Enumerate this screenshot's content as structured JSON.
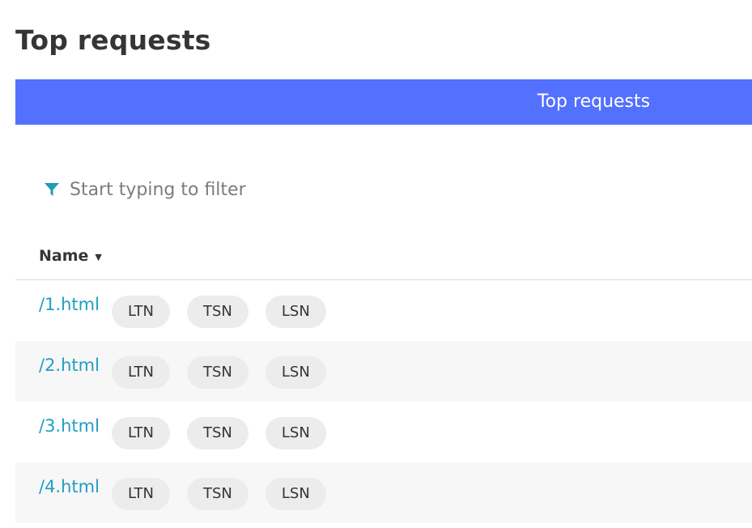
{
  "page": {
    "title": "Top requests"
  },
  "tabs": [
    {
      "label": "Top requests"
    }
  ],
  "filter": {
    "placeholder": "Start typing to filter",
    "icon": "filter-icon"
  },
  "table": {
    "columns": [
      {
        "label": "Name",
        "sort": "descending",
        "sort_icon": "caret-down-icon"
      }
    ],
    "rows": [
      {
        "name": "/1.html",
        "tags": [
          "LTN",
          "TSN",
          "LSN"
        ]
      },
      {
        "name": "/2.html",
        "tags": [
          "LTN",
          "TSN",
          "LSN"
        ]
      },
      {
        "name": "/3.html",
        "tags": [
          "LTN",
          "TSN",
          "LSN"
        ]
      },
      {
        "name": "/4.html",
        "tags": [
          "LTN",
          "TSN",
          "LSN"
        ]
      }
    ]
  },
  "colors": {
    "tab_bar": "#5470ff",
    "link": "#1f9fc2",
    "filter_icon": "#1a9eb4",
    "chip_bg": "#ececec",
    "row_alt_bg": "#f7f7f7"
  }
}
